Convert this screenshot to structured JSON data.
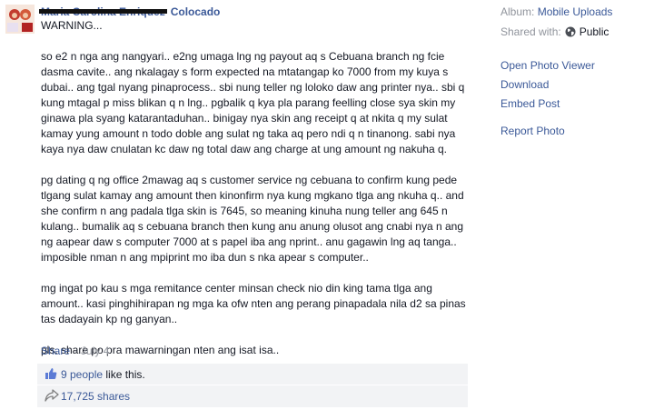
{
  "post": {
    "author_extra": "Colocado",
    "subtitle": "WARNING...",
    "paragraphs": [
      "so e2 n nga ang nangyari.. e2ng umaga lng ng payout aq s Cebuana branch ng fcie dasma cavite.. ang nkalagay s form expected na mtatangap ko 7000 from my kuya s dubai.. ang tgal nyang pinaprocess.. sbi nung teller ng loloko daw ang printer nya.. sbi q kung mtagal p miss blikan q n lng.. pgbalik q kya pla parang feelling close sya skin my ginawa pla syang katarantaduhan.. binigay nya skin ang receipt q at nkita q my sulat kamay yung amount n todo doble ang sulat ng taka aq pero ndi q n tinanong. sabi nya kaya nya daw cnulatan kc daw ng total daw ang charge at ung amount ng nakuha q.",
      "pg dating q ng office 2mawag aq s customer service ng cebuana to confirm kung pede tlgang sulat kamay ang amount then kinonfirm nya kung mgkano tlga ang nkuha q.. and she confirm n ang padala tlga skin is 7645, so meaning kinuha nung teller ang 645 n kulang.. bumalik aq s cebuana branch then kung anu anung olusot ang cnabi nya n ang ng aapear daw s computer 7000 at s papel iba ang nprint.. anu gagawin lng aq tanga.. imposible nman n ang mpiprint mo iba dun s nka apear s computer..",
      "mg ingat po kau s mga remitance center minsan check nio din king tama tlga ang amount.. kasi pinghihirapan ng mga ka ofw nten ang perang pinapadala nila d2 sa pinas tas dadayain kp ng ganyan..",
      "pls. share po pra mawarningan nten ang isat isa.."
    ],
    "share_link": "Share",
    "separator": "·",
    "date": "July 4"
  },
  "ufi": {
    "likes_count": "9 people",
    "likes_suffix": " like this.",
    "shares_count": "17,725 shares"
  },
  "sidebar": {
    "album_label": "Album:",
    "album_value": "Mobile Uploads",
    "shared_label": "Shared with:",
    "shared_value": "Public",
    "actions": [
      "Open Photo Viewer",
      "Download",
      "Embed Post"
    ],
    "report": "Report Photo"
  },
  "colors": {
    "link": "#3b5998",
    "muted": "#90949c",
    "ufi_background": "#f2f3f5"
  },
  "icons": [
    "like-icon",
    "share-icon",
    "globe-icon"
  ]
}
